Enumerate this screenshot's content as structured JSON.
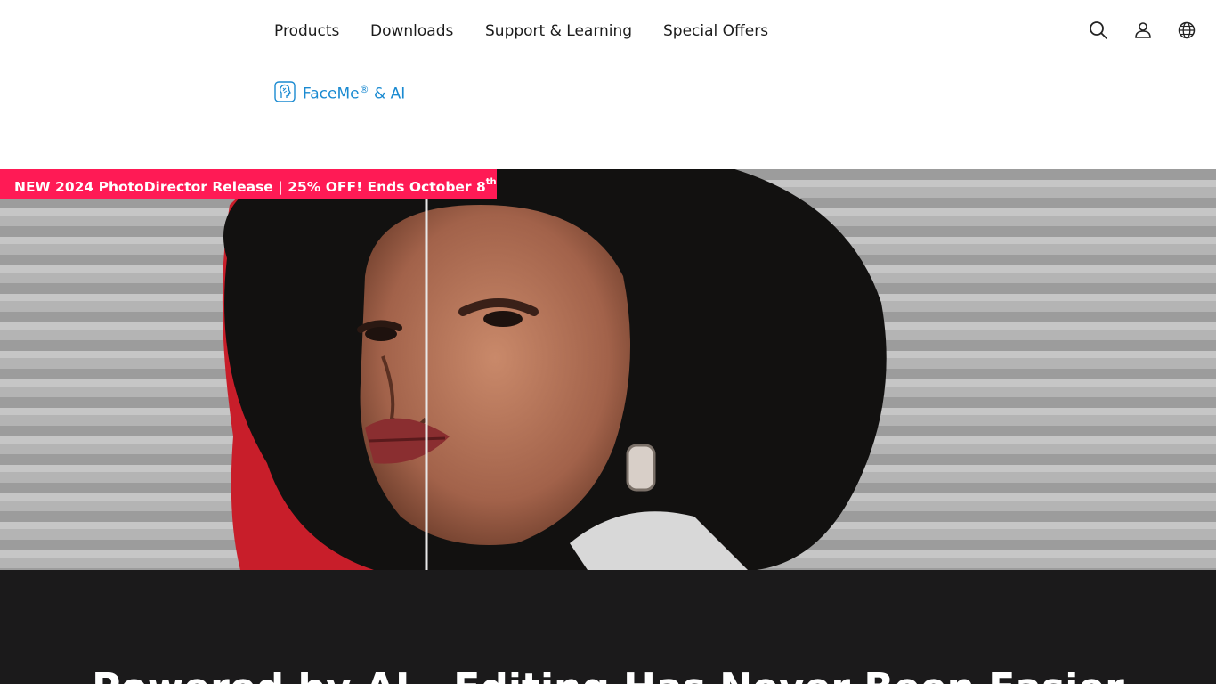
{
  "nav": {
    "items": [
      {
        "label": "Products"
      },
      {
        "label": "Downloads"
      },
      {
        "label": "Support & Learning"
      },
      {
        "label": "Special Offers"
      }
    ],
    "icons": [
      "search-icon",
      "user-icon",
      "globe-icon"
    ]
  },
  "subnav": {
    "icon": "face-scan-icon",
    "label": "FaceMe",
    "registered": "®",
    "suffix": " & AI",
    "color": "#1a8ad1"
  },
  "promo": {
    "text": "NEW 2024 PhotoDirector Release | 25% OFF! Ends October 8",
    "superscript": "th",
    "color": "#ff1a55"
  },
  "hero": {
    "image": "before-after portrait of a woman with curly hair, red background on the left half"
  },
  "section": {
    "headline": "Powered by AI - Editing Has Never Been Easier",
    "background": "#1b1a1b"
  }
}
